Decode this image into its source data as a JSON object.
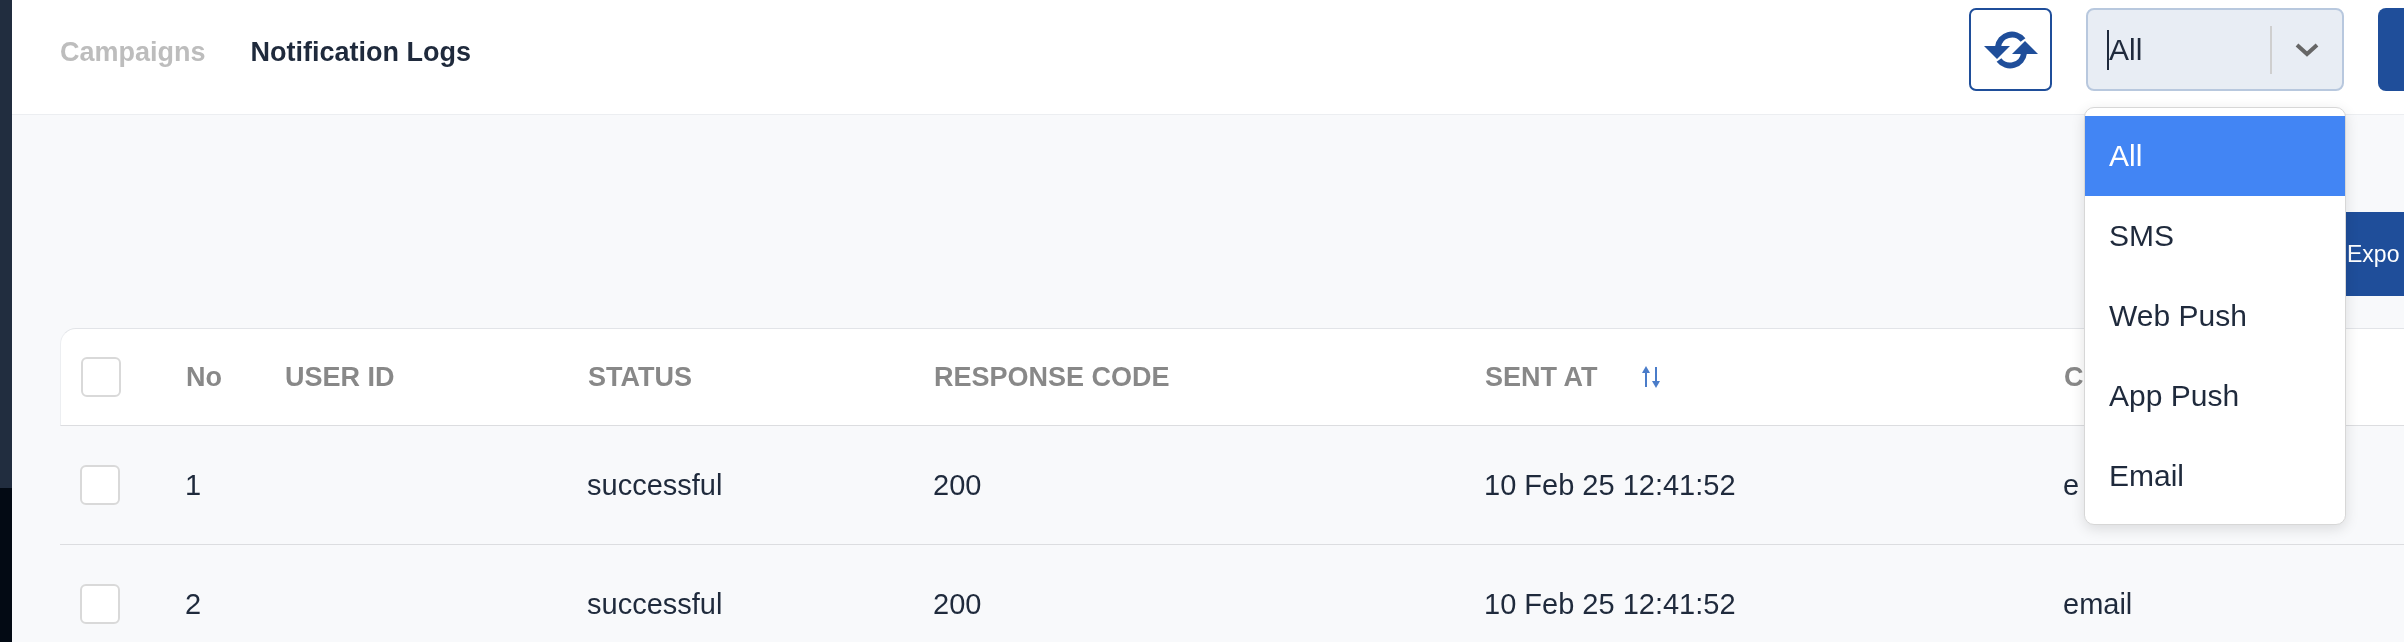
{
  "tabs": [
    {
      "label": "Campaigns",
      "selected": false
    },
    {
      "label": "Notification Logs",
      "selected": true
    }
  ],
  "toolbar": {
    "channel_filter": {
      "value": "All",
      "expanded": true,
      "options": [
        {
          "label": "All",
          "selected": true
        },
        {
          "label": "SMS",
          "selected": false
        },
        {
          "label": "Web Push",
          "selected": false
        },
        {
          "label": "App Push",
          "selected": false
        },
        {
          "label": "Email",
          "selected": false
        }
      ]
    }
  },
  "export_button": {
    "label": "Expo"
  },
  "table": {
    "select_all": {
      "checked": false
    },
    "columns": [
      {
        "label": "No",
        "sortable": false
      },
      {
        "label": "USER ID",
        "sortable": false
      },
      {
        "label": "STATUS",
        "sortable": false
      },
      {
        "label": "RESPONSE CODE",
        "sortable": false
      },
      {
        "label": "SENT AT",
        "sortable": true
      },
      {
        "label": "C",
        "sortable": false
      }
    ],
    "rows": [
      {
        "checked": false,
        "no": "1",
        "status": "successful",
        "response_code": "200",
        "sent_at": "10 Feb 25 12:41:52",
        "column_6": "e"
      },
      {
        "checked": false,
        "no": "2",
        "status": "successful",
        "response_code": "200",
        "sent_at": "10 Feb 25 12:41:52",
        "column_6": "email"
      }
    ]
  }
}
